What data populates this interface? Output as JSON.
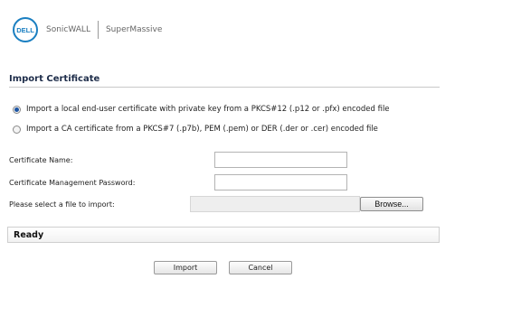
{
  "header": {
    "logo_text": "DELL",
    "brand": "SonicWALL",
    "product": "SuperMassive"
  },
  "section": {
    "title": "Import Certificate"
  },
  "options": [
    {
      "label": "Import a local end-user certificate with private key from a PKCS#12 (.p12 or .pfx) encoded file",
      "selected": true
    },
    {
      "label": "Import a CA certificate from a PKCS#7 (.p7b), PEM (.pem) or DER (.der or .cer) encoded file",
      "selected": false
    }
  ],
  "fields": {
    "cert_name_label": "Certificate Name:",
    "cert_name_value": "",
    "password_label": "Certificate Management Password:",
    "password_value": "",
    "file_label": "Please select a file to import:",
    "browse_label": "Browse..."
  },
  "status": {
    "text": "Ready"
  },
  "buttons": {
    "import": "Import",
    "cancel": "Cancel"
  },
  "colors": {
    "brand_blue": "#1a7fc1",
    "title": "#1e2d4a",
    "radio_selected": "#1c55a3"
  }
}
